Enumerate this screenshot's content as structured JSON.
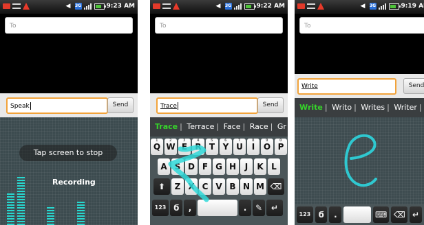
{
  "screens": [
    {
      "status": {
        "time": "9:23 AM"
      },
      "to_placeholder": "To",
      "message_text": "Speak",
      "send_label": "Send",
      "tap_to_stop": "Tap screen to stop",
      "recording_label": "Recording"
    },
    {
      "status": {
        "time": "9:22 AM"
      },
      "to_placeholder": "To",
      "message_text": "Trace",
      "send_label": "Send",
      "suggestions": [
        "Trace",
        "Terrace",
        "Face",
        "Race",
        "Gr"
      ],
      "keyboard": {
        "row1": [
          "Q",
          "W",
          "E",
          "R",
          "T",
          "Y",
          "U",
          "I",
          "O",
          "P"
        ],
        "row1_digits": [
          "1",
          "2",
          "3",
          "4",
          "5",
          "6",
          "7",
          "8",
          "9",
          "0"
        ],
        "row2": [
          "A",
          "S",
          "D",
          "F",
          "G",
          "H",
          "J",
          "K",
          "L"
        ],
        "row3": [
          "Z",
          "X",
          "C",
          "V",
          "B",
          "N",
          "M"
        ],
        "sym_label": "123",
        "comma": ",",
        "period": "."
      }
    },
    {
      "status": {
        "time": "9:19 AM"
      },
      "to_placeholder": "To",
      "message_text": "Write",
      "send_label": "Send",
      "suggestions": [
        "Write",
        "Writo",
        "Writes",
        "Writer"
      ],
      "sym_label": "123",
      "period": "."
    }
  ],
  "colors": {
    "accent_green": "#36d32a",
    "trace_cyan": "#2fd8d8",
    "focus_orange": "#f2a33a"
  },
  "icons": [
    "message-icon",
    "usb-icon",
    "warning-icon",
    "mute-icon",
    "3g-icon",
    "signal-icon",
    "battery-icon",
    "shift-icon",
    "backspace-icon",
    "enter-icon",
    "swype-icon",
    "mic-icon",
    "keyboard-icon"
  ]
}
